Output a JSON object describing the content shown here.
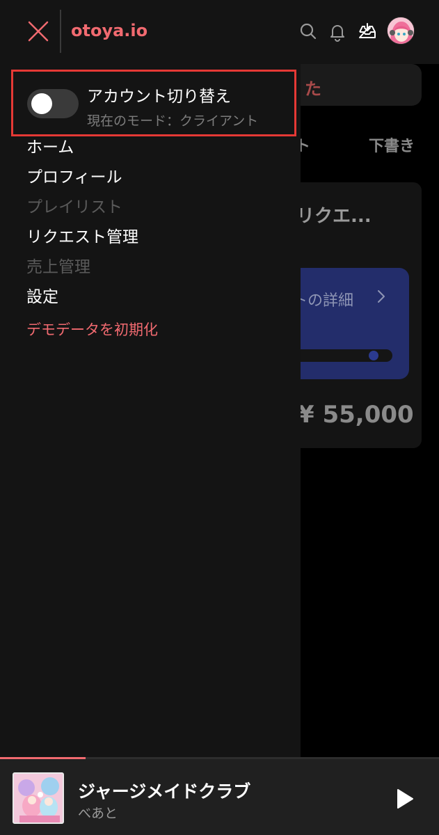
{
  "header": {
    "logo": "otoya.io"
  },
  "account_switch": {
    "title": "アカウント切り替え",
    "subtitle": "現在のモード：クライアント",
    "enabled": false
  },
  "menu": {
    "items": [
      {
        "label": "ホーム",
        "state": "active"
      },
      {
        "label": "プロフィール",
        "state": "active"
      },
      {
        "label": "プレイリスト",
        "state": "disabled"
      },
      {
        "label": "リクエスト管理",
        "state": "active"
      },
      {
        "label": "売上管理",
        "state": "disabled"
      },
      {
        "label": "設定",
        "state": "active"
      }
    ],
    "reset_label": "デモデータを初期化"
  },
  "background": {
    "banner_text": "た",
    "tabs": [
      "エスト",
      "下書き"
    ],
    "card_title": "たリクエ...",
    "detail_link": "トの詳細",
    "price": "¥ 55,000"
  },
  "player": {
    "title": "ジャージメイドクラブ",
    "artist": "べあと",
    "progress": 0.195
  },
  "colors": {
    "accent": "#f16a70",
    "highlight_border": "#e53935",
    "drawer_bg": "#141414",
    "detail_card": "#232d6b"
  }
}
